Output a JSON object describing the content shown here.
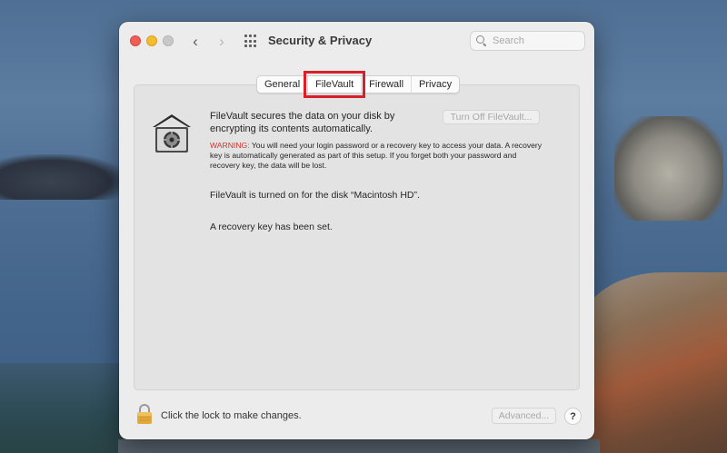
{
  "window": {
    "title": "Security & Privacy"
  },
  "search": {
    "placeholder": "Search"
  },
  "tabs": [
    {
      "label": "General",
      "active": false
    },
    {
      "label": "FileVault",
      "active": true
    },
    {
      "label": "Firewall",
      "active": false
    },
    {
      "label": "Privacy",
      "active": false
    }
  ],
  "filevault": {
    "description": "FileVault secures the data on your disk by encrypting its contents automatically.",
    "turn_off_label": "Turn Off FileVault...",
    "warning_label": "WARNING:",
    "warning_text": "You will need your login password or a recovery key to access your data. A recovery key is automatically generated as part of this setup. If you forget both your password and recovery key, the data will be lost.",
    "status": "FileVault is turned on for the disk “Macintosh HD”.",
    "recovery_status": "A recovery key has been set."
  },
  "footer": {
    "lock_label": "Click the lock to make changes.",
    "advanced_label": "Advanced...",
    "help_label": "?"
  },
  "colors": {
    "highlight_box": "#d6212b",
    "warning_red": "#d0342c"
  },
  "icons": {
    "vault": "filevault-safe-icon",
    "lock": "padlock-icon"
  }
}
